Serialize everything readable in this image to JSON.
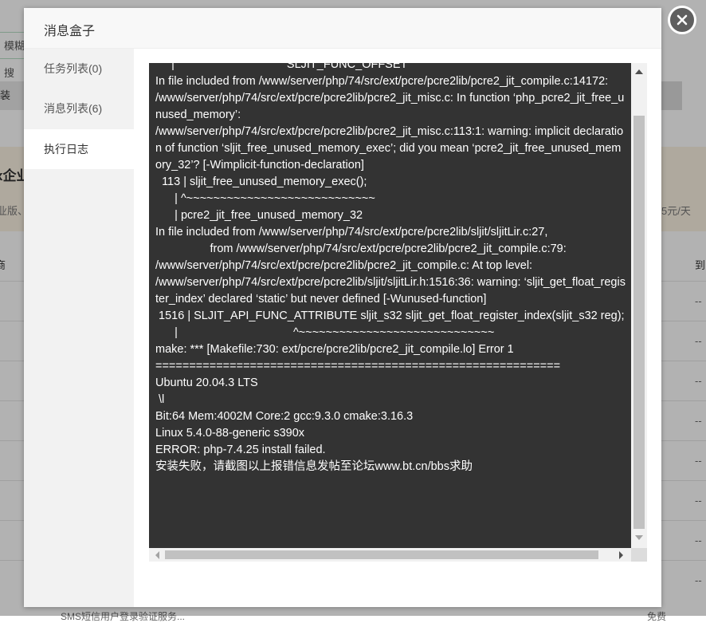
{
  "background": {
    "search_partial": "模糊搜",
    "install_partial": "装",
    "banner_title_partial": "x企业",
    "banner_sub_partial": "业版、",
    "banner_price_partial": "5元/天",
    "col_left_partial": "商",
    "col_right_partial": "到",
    "row_dash": "--",
    "bottom_left_partial": "SMS短信用户登录验证服务...",
    "bottom_right_partial": "免费"
  },
  "modal": {
    "title": "消息盒子",
    "close_icon": "close-icon",
    "sidebar": [
      {
        "label": "任务列表(0)",
        "active": false
      },
      {
        "label": "消息列表(6)",
        "active": false
      },
      {
        "label": "执行日志",
        "active": true
      }
    ]
  },
  "log": {
    "lines": [
      "     |                                   SLJIT_FUNC_OFFSET",
      "In file included from /www/server/php/74/src/ext/pcre/pcre2lib/pcre2_jit_compile.c:14172:",
      "/www/server/php/74/src/ext/pcre/pcre2lib/pcre2_jit_misc.c: In function ‘php_pcre2_jit_free_unused_memory’:",
      "/www/server/php/74/src/ext/pcre/pcre2lib/pcre2_jit_misc.c:113:1: warning: implicit declaration of function ‘sljit_free_unused_memory_exec’; did you mean ‘pcre2_jit_free_unused_memory_32’? [-Wimplicit-function-declaration]",
      "  113 | sljit_free_unused_memory_exec();",
      "      | ^~~~~~~~~~~~~~~~~~~~~~~~~~~~~",
      "      | pcre2_jit_free_unused_memory_32",
      "In file included from /www/server/php/74/src/ext/pcre/pcre2lib/sljit/sljitLir.c:27,",
      "                 from /www/server/php/74/src/ext/pcre/pcre2lib/pcre2_jit_compile.c:79:",
      "/www/server/php/74/src/ext/pcre/pcre2lib/pcre2_jit_compile.c: At top level:",
      "/www/server/php/74/src/ext/pcre/pcre2lib/sljit/sljitLir.h:1516:36: warning: ‘sljit_get_float_register_index’ declared ‘static’ but never defined [-Wunused-function]",
      " 1516 | SLJIT_API_FUNC_ATTRIBUTE sljit_s32 sljit_get_float_register_index(sljit_s32 reg);",
      "      |                                    ^~~~~~~~~~~~~~~~~~~~~~~~~~~~~~",
      "make: *** [Makefile:730: ext/pcre/pcre2lib/pcre2_jit_compile.lo] Error 1",
      "============================================================",
      "Ubuntu 20.04.3 LTS",
      " \\l",
      "Bit:64 Mem:4002M Core:2 gcc:9.3.0 cmake:3.16.3",
      "Linux 5.4.0-88-generic s390x",
      "ERROR: php-7.4.25 install failed.",
      "安装失败，请截图以上报错信息发帖至论坛www.bt.cn/bbs求助"
    ]
  }
}
